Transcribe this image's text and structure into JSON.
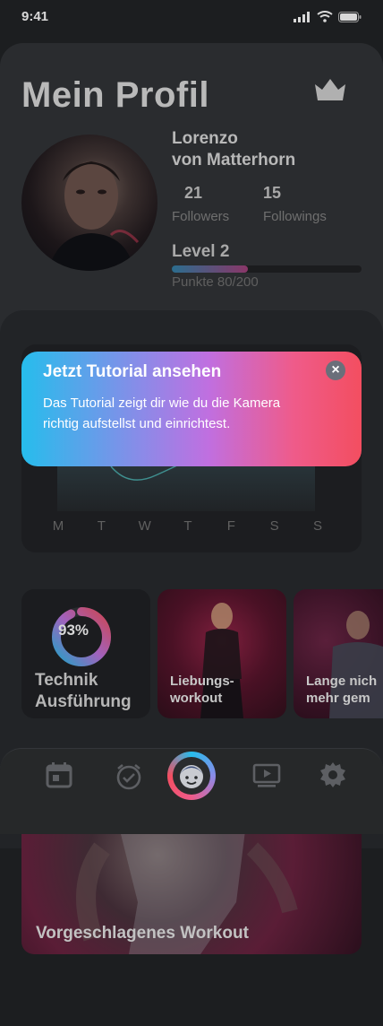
{
  "status_bar": {
    "time": "9:41"
  },
  "profile": {
    "title": "Mein Profil",
    "name_line1": "Lorenzo",
    "name_line2": "von Matterhorn",
    "followers_count": "21",
    "followers_label": "Followers",
    "followings_count": "15",
    "followings_label": "Followings",
    "level": "Level 2",
    "points": "Punkte 80/200",
    "points_progress": 0.4
  },
  "tutorial": {
    "title": "Jetzt Tutorial ansehen",
    "body": "Das Tutorial zeigt dir wie du die Kamera richtig aufstellst und einrichtest.",
    "close": "×"
  },
  "chart": {
    "days": [
      "M",
      "T",
      "W",
      "T",
      "F",
      "S",
      "S"
    ]
  },
  "tiles": {
    "technik_percent": "93%",
    "technik_progress": 0.93,
    "technik_line1": "Technik",
    "technik_line2": "Ausführung",
    "workout1_line1": "Liebungs-",
    "workout1_line2": "workout",
    "workout2_line1": "Lange nich",
    "workout2_line2": "mehr gem"
  },
  "nav": {
    "icons": [
      "calendar-icon",
      "alarm-check-icon",
      "face-icon",
      "video-play-icon",
      "settings-icon"
    ]
  },
  "suggested": {
    "label": "Vorgeschlagenes Workout"
  },
  "colors": {
    "gradient_start": "#26bdec",
    "gradient_mid": "#c06fe0",
    "gradient_end": "#f34e60"
  }
}
